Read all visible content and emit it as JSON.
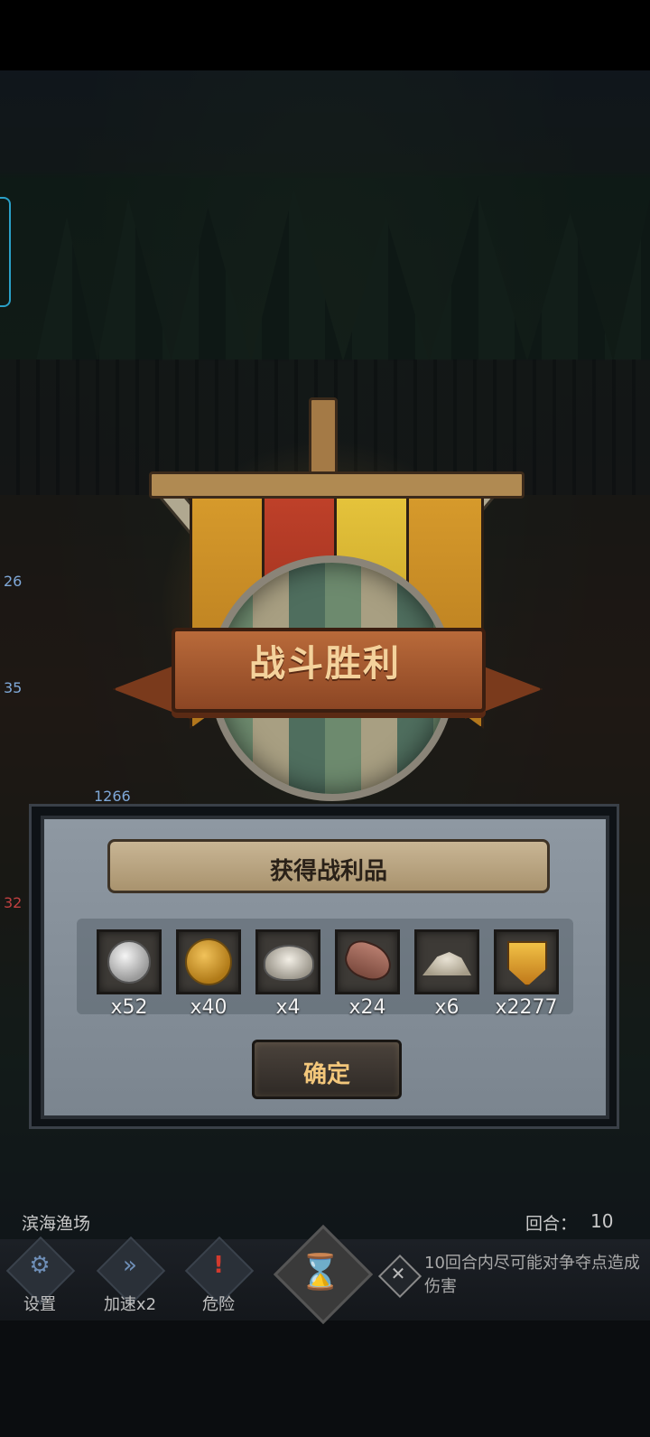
{
  "victory": {
    "title": "战斗胜利"
  },
  "rewards": {
    "title": "获得战利品",
    "items": [
      {
        "icon": "silver-coin-icon",
        "count": "x52"
      },
      {
        "icon": "gold-coin-icon",
        "count": "x40"
      },
      {
        "icon": "oyster-icon",
        "count": "x4"
      },
      {
        "icon": "fish-icon",
        "count": "x24"
      },
      {
        "icon": "salt-pile-icon",
        "count": "x6"
      },
      {
        "icon": "honor-badge-icon",
        "count": "x2277"
      }
    ],
    "confirm_label": "确定"
  },
  "battlefield": {
    "markers": [
      "26",
      "35",
      "1266",
      "32"
    ]
  },
  "hud": {
    "location": "滨海渔场",
    "round_label": "回合：",
    "round_value": "10",
    "buttons": [
      {
        "icon": "gear-icon",
        "label": "设置"
      },
      {
        "icon": "fast-forward-icon",
        "label": "加速x2"
      },
      {
        "icon": "exclamation-icon",
        "label": "危险"
      }
    ],
    "hourglass_icon": "hourglass-icon",
    "objective_icon": "crossed-swords-icon",
    "objective_text": "10回合内尽可能对争夺点造成伤害"
  },
  "colors": {
    "title_text": "#f4d29c",
    "confirm_text": "#f3c77b",
    "danger": "#d23a2e",
    "accent_blue": "#2aa0c8"
  }
}
